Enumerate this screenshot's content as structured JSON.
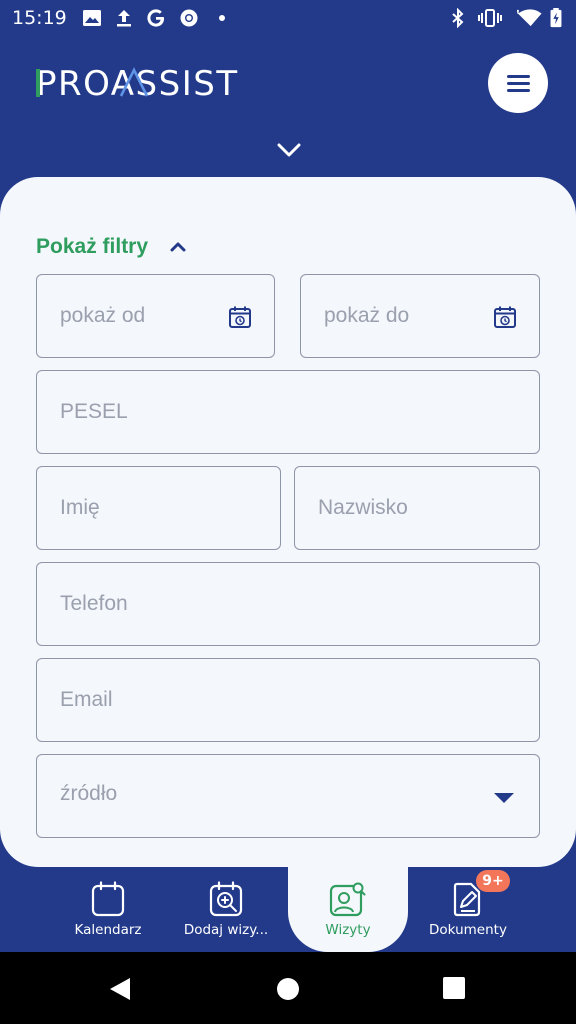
{
  "status_bar": {
    "time": "15:19",
    "left_icons": [
      "image-icon",
      "upload-icon",
      "google-icon",
      "chrome-icon",
      "dot-icon"
    ],
    "right_icons": [
      "bluetooth-icon",
      "vibrate-icon",
      "wifi-icon",
      "battery-icon"
    ]
  },
  "header": {
    "logo_text": "PROASSIST",
    "menu_icon": "hamburger-icon",
    "collapse_icon": "chevron-down-icon"
  },
  "filters": {
    "toggle_label": "Pokaż filtry",
    "toggle_icon": "chevron-up-icon",
    "date_from_placeholder": "pokaż od",
    "date_to_placeholder": "pokaż do",
    "pesel_placeholder": "PESEL",
    "first_name_placeholder": "Imię",
    "last_name_placeholder": "Nazwisko",
    "phone_placeholder": "Telefon",
    "email_placeholder": "Email",
    "source_placeholder": "źródło"
  },
  "bottom_nav": {
    "items": [
      {
        "label": "Kalendarz",
        "icon": "calendar-icon",
        "active": false
      },
      {
        "label": "Dodaj wizy...",
        "icon": "calendar-search-icon",
        "active": false
      },
      {
        "label": "Wizyty",
        "icon": "patient-search-icon",
        "active": true
      },
      {
        "label": "Dokumenty",
        "icon": "document-edit-icon",
        "active": false
      }
    ],
    "documents_badge": "9+"
  },
  "colors": {
    "brand_blue": "#233a8b",
    "accent_green": "#2e9d5e",
    "badge": "#f3765b",
    "card_bg": "#f4f7fc"
  }
}
